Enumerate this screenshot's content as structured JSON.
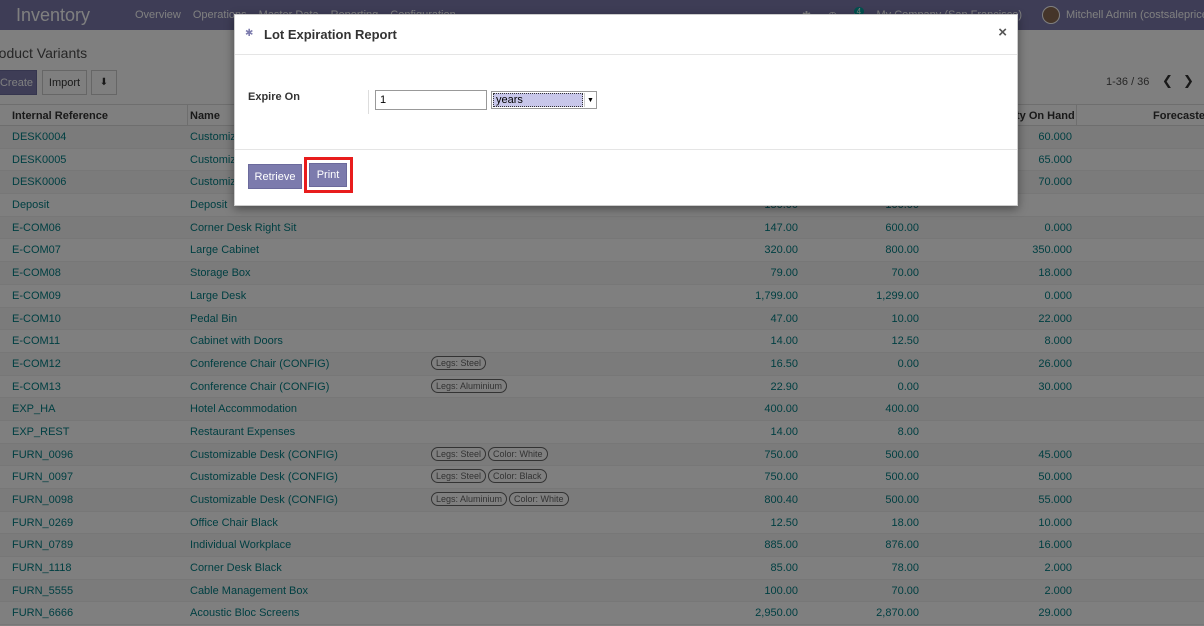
{
  "navbar": {
    "app_title": "Inventory",
    "menu": [
      "Overview",
      "Operations",
      "Master Data",
      "Reporting",
      "Configuration"
    ],
    "chat_badge": "4",
    "company": "My Company (San Francisco)",
    "user": "Mitchell Admin (costsaleprice"
  },
  "control_panel": {
    "breadcrumb": "roduct Variants",
    "create_label": "Create",
    "import_label": "Import",
    "pager": "1-36 / 36"
  },
  "table": {
    "headers": {
      "internal_reference": "Internal Reference",
      "name": "Name",
      "qty_on_hand": "ty On Hand",
      "forecasted": "Forecasted"
    },
    "rows": [
      {
        "ref": "DESK0004",
        "name": "Customiz",
        "tags": [],
        "price": "",
        "cost": "",
        "qty": "60.000"
      },
      {
        "ref": "DESK0005",
        "name": "Customiz",
        "tags": [],
        "price": "",
        "cost": "",
        "qty": "65.000"
      },
      {
        "ref": "DESK0006",
        "name": "Customiz",
        "tags": [],
        "price": "",
        "cost": "",
        "qty": "70.000"
      },
      {
        "ref": "Deposit",
        "name": "Deposit",
        "tags": [],
        "price": "150.00",
        "cost": "100.00",
        "qty": ""
      },
      {
        "ref": "E-COM06",
        "name": "Corner Desk Right Sit",
        "tags": [],
        "price": "147.00",
        "cost": "600.00",
        "qty": "0.000"
      },
      {
        "ref": "E-COM07",
        "name": "Large Cabinet",
        "tags": [],
        "price": "320.00",
        "cost": "800.00",
        "qty": "350.000"
      },
      {
        "ref": "E-COM08",
        "name": "Storage Box",
        "tags": [],
        "price": "79.00",
        "cost": "70.00",
        "qty": "18.000"
      },
      {
        "ref": "E-COM09",
        "name": "Large Desk",
        "tags": [],
        "price": "1,799.00",
        "cost": "1,299.00",
        "qty": "0.000"
      },
      {
        "ref": "E-COM10",
        "name": "Pedal Bin",
        "tags": [],
        "price": "47.00",
        "cost": "10.00",
        "qty": "22.000"
      },
      {
        "ref": "E-COM11",
        "name": "Cabinet with Doors",
        "tags": [],
        "price": "14.00",
        "cost": "12.50",
        "qty": "8.000"
      },
      {
        "ref": "E-COM12",
        "name": "Conference Chair (CONFIG)",
        "tags": [
          "Legs: Steel"
        ],
        "price": "16.50",
        "cost": "0.00",
        "qty": "26.000"
      },
      {
        "ref": "E-COM13",
        "name": "Conference Chair (CONFIG)",
        "tags": [
          "Legs: Aluminium"
        ],
        "price": "22.90",
        "cost": "0.00",
        "qty": "30.000"
      },
      {
        "ref": "EXP_HA",
        "name": "Hotel Accommodation",
        "tags": [],
        "price": "400.00",
        "cost": "400.00",
        "qty": ""
      },
      {
        "ref": "EXP_REST",
        "name": "Restaurant Expenses",
        "tags": [],
        "price": "14.00",
        "cost": "8.00",
        "qty": ""
      },
      {
        "ref": "FURN_0096",
        "name": "Customizable Desk (CONFIG)",
        "tags": [
          "Legs: Steel",
          "Color: White"
        ],
        "price": "750.00",
        "cost": "500.00",
        "qty": "45.000"
      },
      {
        "ref": "FURN_0097",
        "name": "Customizable Desk (CONFIG)",
        "tags": [
          "Legs: Steel",
          "Color: Black"
        ],
        "price": "750.00",
        "cost": "500.00",
        "qty": "50.000"
      },
      {
        "ref": "FURN_0098",
        "name": "Customizable Desk (CONFIG)",
        "tags": [
          "Legs: Aluminium",
          "Color: White"
        ],
        "price": "800.40",
        "cost": "500.00",
        "qty": "55.000"
      },
      {
        "ref": "FURN_0269",
        "name": "Office Chair Black",
        "tags": [],
        "price": "12.50",
        "cost": "18.00",
        "qty": "10.000"
      },
      {
        "ref": "FURN_0789",
        "name": "Individual Workplace",
        "tags": [],
        "price": "885.00",
        "cost": "876.00",
        "qty": "16.000"
      },
      {
        "ref": "FURN_1118",
        "name": "Corner Desk Black",
        "tags": [],
        "price": "85.00",
        "cost": "78.00",
        "qty": "2.000"
      },
      {
        "ref": "FURN_5555",
        "name": "Cable Management Box",
        "tags": [],
        "price": "100.00",
        "cost": "70.00",
        "qty": "2.000"
      },
      {
        "ref": "FURN_6666",
        "name": "Acoustic Bloc Screens",
        "tags": [],
        "price": "2,950.00",
        "cost": "2,870.00",
        "qty": "29.000"
      }
    ]
  },
  "modal": {
    "title": "Lot Expiration Report",
    "close_glyph": "×",
    "field_label": "Expire On",
    "expire_value": "1",
    "unit_value": "years",
    "retrieve_label": "Retrieve",
    "print_label": "Print"
  },
  "colors": {
    "brand": "#7c7bad",
    "link": "#017e84",
    "highlight": "#e81c1c"
  }
}
